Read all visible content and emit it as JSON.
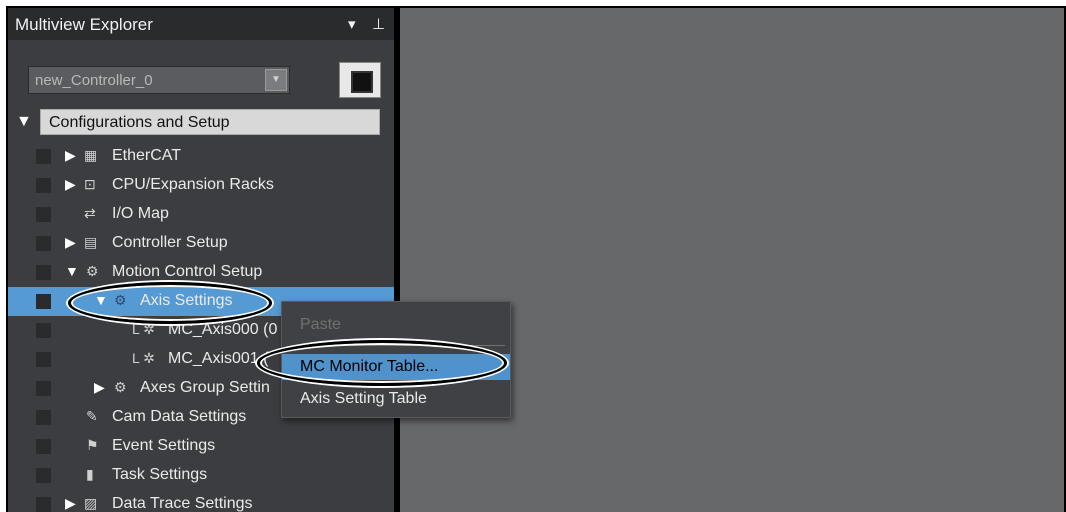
{
  "panel": {
    "title": "Multiview Explorer",
    "dropdown_icon": "▾",
    "pin_icon": "⊥",
    "controller_value": "new_Controller_0",
    "select_arrow": "▼"
  },
  "tree": {
    "root": {
      "arrow": "▼",
      "label": "Configurations and Setup"
    },
    "items": [
      {
        "arrow": "▶",
        "icon": "▦",
        "label": "EtherCAT"
      },
      {
        "arrow": "▶",
        "icon": "⊡",
        "label": "CPU/Expansion Racks"
      },
      {
        "arrow": "",
        "icon": "⇄",
        "label": "I/O Map"
      },
      {
        "arrow": "▶",
        "icon": "▤",
        "label": "Controller Setup"
      },
      {
        "arrow": "▼",
        "icon": "⚙",
        "label": "Motion Control Setup"
      },
      {
        "arrow": "▼",
        "icon": "⚙",
        "label": "Axis Settings"
      },
      {
        "arrow": "",
        "icon": "L ✲",
        "label": "MC_Axis000 (0"
      },
      {
        "arrow": "",
        "icon": "L ✲",
        "label": "MC_Axis001 ("
      },
      {
        "arrow": "▶",
        "icon": "⚙",
        "label": "Axes Group Settin"
      },
      {
        "arrow": "",
        "icon": "✎",
        "label": "Cam Data Settings"
      },
      {
        "arrow": "",
        "icon": "⚑",
        "label": "Event Settings"
      },
      {
        "arrow": "",
        "icon": "▮",
        "label": "Task Settings"
      },
      {
        "arrow": "▶",
        "icon": "▨",
        "label": "Data Trace Settings"
      }
    ]
  },
  "context_menu": {
    "items": [
      {
        "label": "Paste"
      },
      {
        "label": "MC Monitor Table..."
      },
      {
        "label": "Axis Setting Table"
      }
    ]
  },
  "colors": {
    "panel_bg": "#3b3d40",
    "selected_row": "#569ad3",
    "workspace_bg": "#67686a"
  }
}
